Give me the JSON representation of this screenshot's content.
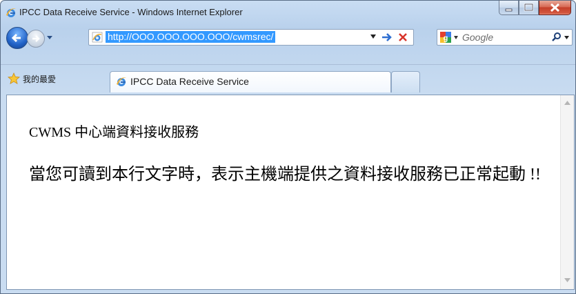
{
  "window": {
    "title": "IPCC Data Receive Service - Windows Internet Explorer",
    "controls": [
      "minimize",
      "maximize",
      "close"
    ]
  },
  "navigation": {
    "address_url": "http://OOO.OOO.OOO.OOO/cwmsrec/",
    "search_placeholder": "Google",
    "icons": [
      "back-icon",
      "forward-icon",
      "history-dropdown-icon",
      "ie-page-icon",
      "go-arrow-icon",
      "stop-icon",
      "google-icon",
      "search-magnifier-icon"
    ]
  },
  "favorites": {
    "label": "我的最愛"
  },
  "tabs": [
    {
      "label": "IPCC Data Receive Service",
      "active": true
    }
  ],
  "page": {
    "heading": "CWMS 中心端資料接收服務",
    "message": "當您可讀到本行文字時，表示主機端提供之資料接收服務已正常起動 !!"
  },
  "colors": {
    "selection": "#3399ff",
    "close_button": "#c4402a",
    "chrome": "#c3d8ef"
  }
}
